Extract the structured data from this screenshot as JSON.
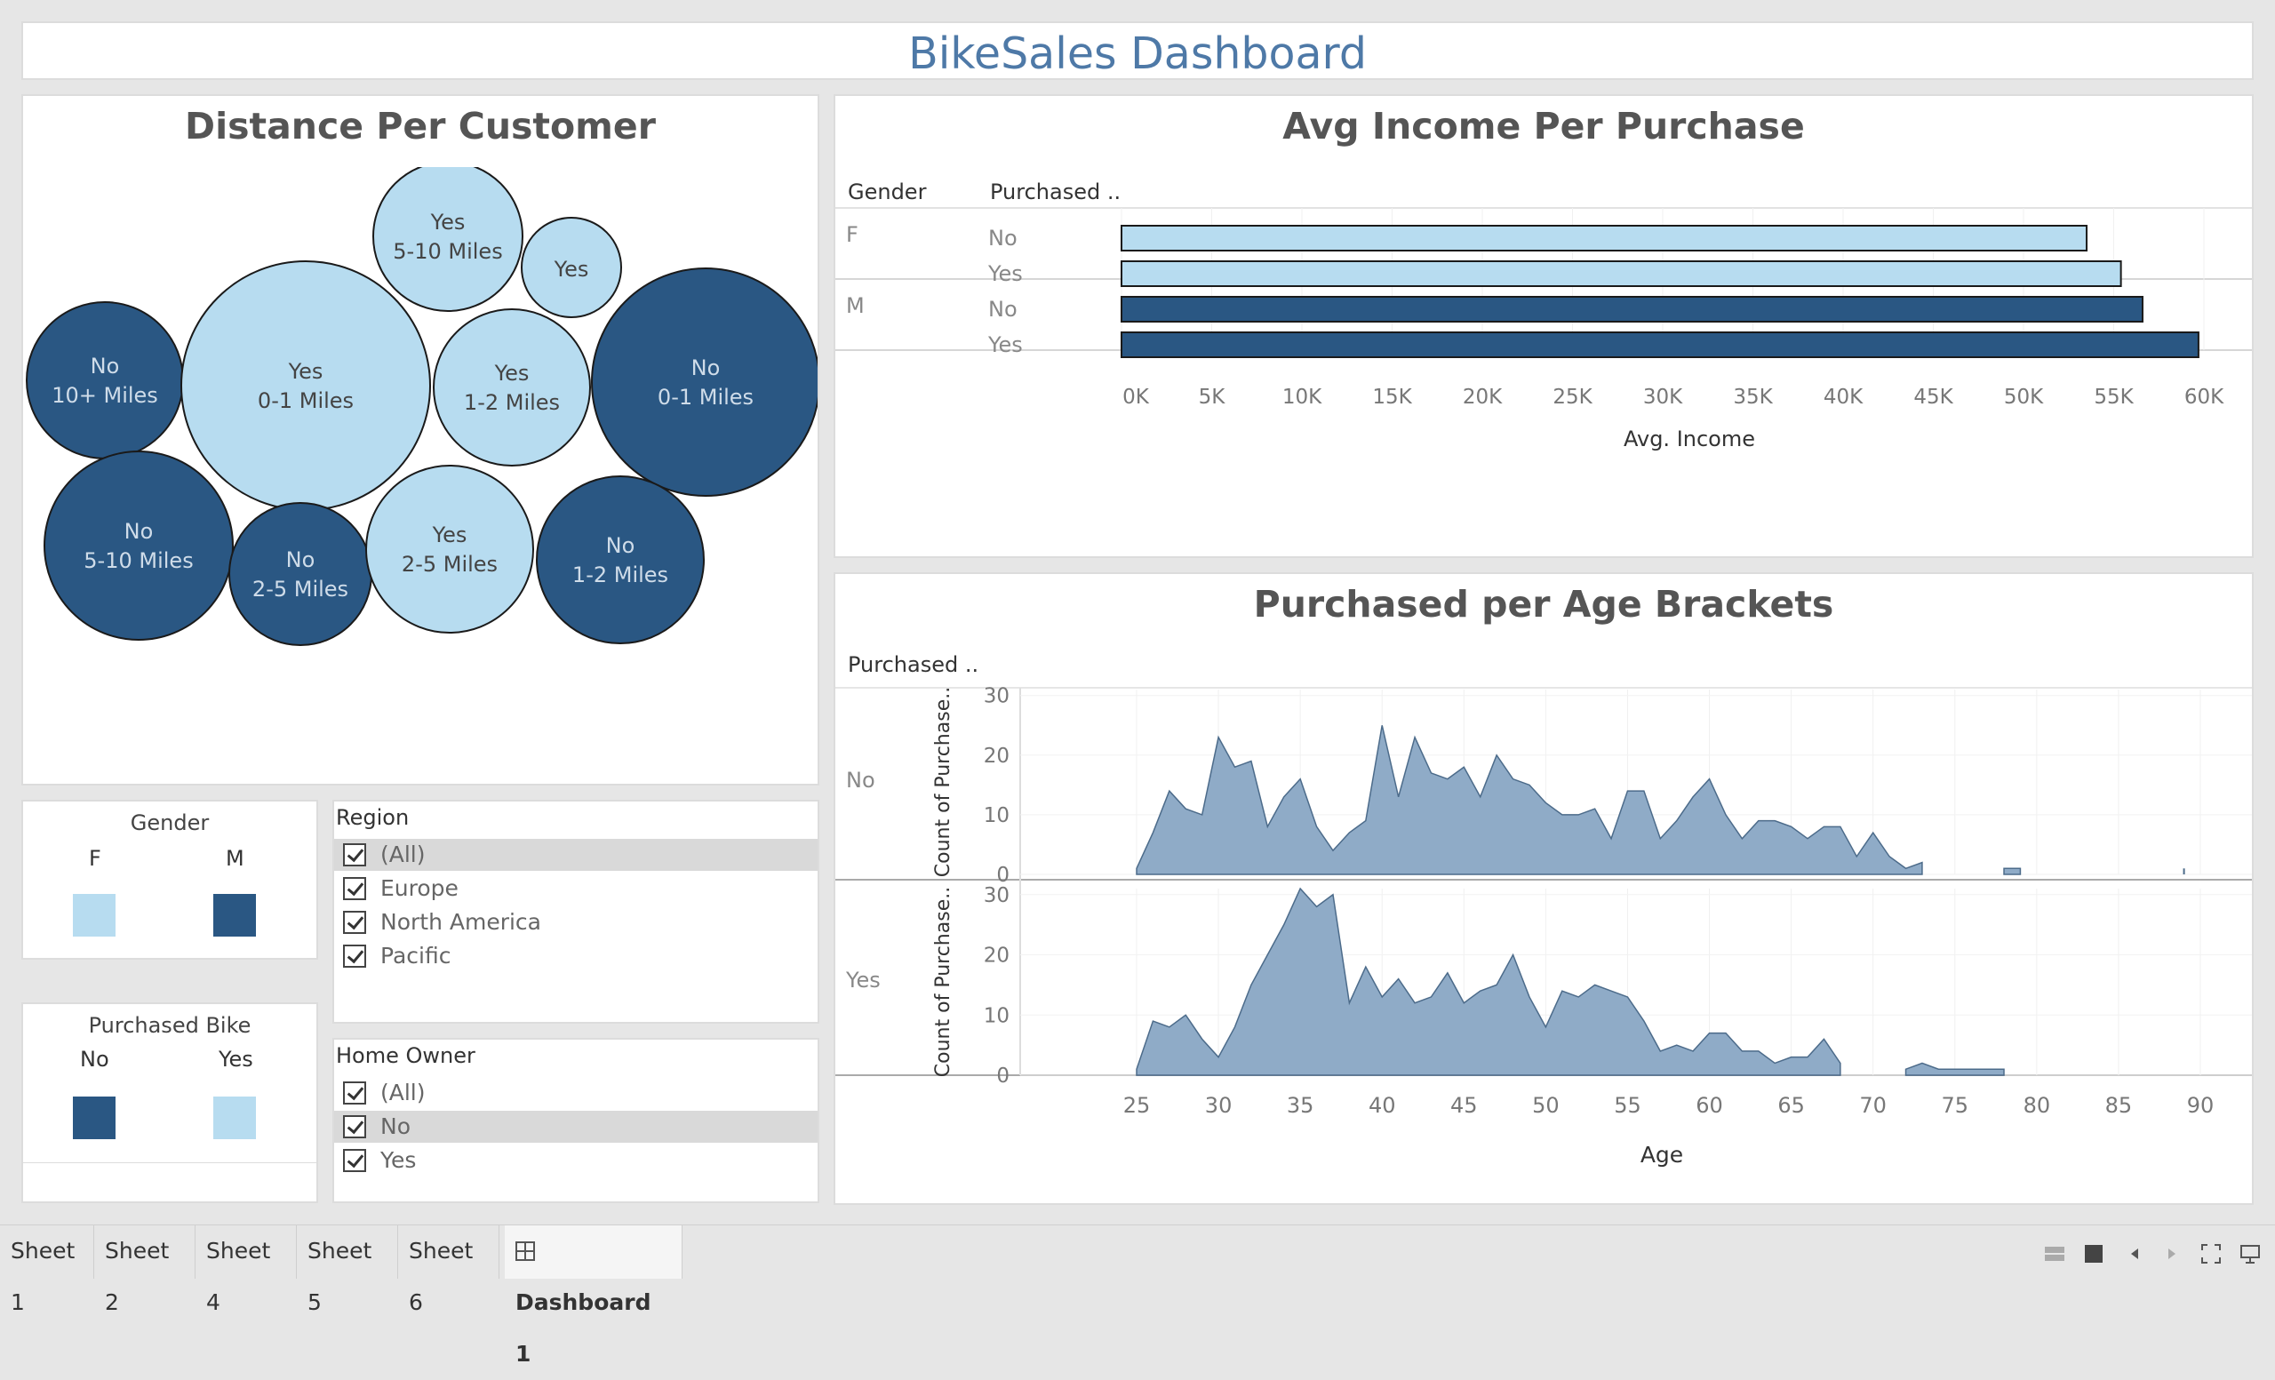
{
  "dashboard": {
    "title": "BikeSales Dashboard"
  },
  "colors": {
    "light": "#b7dcf0",
    "dark": "#2a5783",
    "area": "#8fabc7",
    "area_line": "#4c6b8a",
    "title_blue": "#4e79a7"
  },
  "distance": {
    "title": "Distance Per Customer",
    "bubbles": [
      {
        "l1": "Yes",
        "l2": "5-10 Miles",
        "color": "light"
      },
      {
        "l1": "Yes",
        "l2": "",
        "color": "light"
      },
      {
        "l1": "No",
        "l2": "10+ Miles",
        "color": "dark"
      },
      {
        "l1": "Yes",
        "l2": "0-1 Miles",
        "color": "light"
      },
      {
        "l1": "Yes",
        "l2": "1-2 Miles",
        "color": "light"
      },
      {
        "l1": "No",
        "l2": "0-1 Miles",
        "color": "dark"
      },
      {
        "l1": "No",
        "l2": "5-10 Miles",
        "color": "dark"
      },
      {
        "l1": "No",
        "l2": "2-5 Miles",
        "color": "dark"
      },
      {
        "l1": "Yes",
        "l2": "2-5 Miles",
        "color": "light"
      },
      {
        "l1": "No",
        "l2": "1-2 Miles",
        "color": "dark"
      }
    ]
  },
  "income": {
    "title": "Avg Income Per Purchase",
    "col_gender": "Gender",
    "col_purchased": "Purchased ..",
    "xlabel": "Avg. Income",
    "ticks": [
      "0K",
      "5K",
      "10K",
      "15K",
      "20K",
      "25K",
      "30K",
      "35K",
      "40K",
      "45K",
      "50K",
      "55K",
      "60K"
    ]
  },
  "age": {
    "title": "Purchased per Age Brackets",
    "col_purchased": "Purchased ..",
    "ylabel": "Count of Purchase..",
    "row_no": "No",
    "row_yes": "Yes",
    "xlabel": "Age",
    "yticks": [
      "30",
      "20",
      "10",
      "0"
    ],
    "xticks": [
      "25",
      "30",
      "35",
      "40",
      "45",
      "50",
      "55",
      "60",
      "65",
      "70",
      "75",
      "80",
      "85",
      "90"
    ]
  },
  "gender_legend": {
    "title": "Gender",
    "f": "F",
    "m": "M"
  },
  "purchased_legend": {
    "title": "Purchased Bike",
    "no": "No",
    "yes": "Yes"
  },
  "region": {
    "title": "Region",
    "items": [
      "(All)",
      "Europe",
      "North America",
      "Pacific"
    ]
  },
  "home_owner": {
    "title": "Home Owner",
    "items": [
      "(All)",
      "No",
      "Yes"
    ]
  },
  "tabs": [
    "Sheet 1",
    "Sheet 2",
    "Sheet 4",
    "Sheet 5",
    "Sheet 6",
    "Dashboard 1"
  ],
  "chart_data": [
    {
      "type": "bar",
      "title": "Avg Income Per Purchase",
      "xlabel": "Avg. Income",
      "xlim": [
        0,
        60000
      ],
      "rows": [
        {
          "gender": "F",
          "purchased": "No",
          "value": 53500
        },
        {
          "gender": "F",
          "purchased": "Yes",
          "value": 55400
        },
        {
          "gender": "M",
          "purchased": "No",
          "value": 56600
        },
        {
          "gender": "M",
          "purchased": "Yes",
          "value": 59700
        }
      ]
    },
    {
      "type": "area",
      "title": "Purchased per Age Brackets",
      "xlabel": "Age",
      "ylabel": "Count of Purchase..",
      "xlim": [
        23,
        92
      ],
      "ylim": [
        0,
        30
      ],
      "series": [
        {
          "name": "No",
          "x": [
            25,
            26,
            27,
            28,
            29,
            30,
            31,
            32,
            33,
            34,
            35,
            36,
            37,
            38,
            39,
            40,
            41,
            42,
            43,
            44,
            45,
            46,
            47,
            48,
            49,
            50,
            51,
            52,
            53,
            54,
            55,
            56,
            57,
            58,
            59,
            60,
            61,
            62,
            63,
            64,
            65,
            66,
            67,
            68,
            69,
            70,
            71,
            72,
            73,
            78,
            79,
            89
          ],
          "y": [
            1,
            7,
            14,
            11,
            10,
            23,
            18,
            19,
            8,
            13,
            16,
            8,
            4,
            7,
            9,
            25,
            13,
            23,
            17,
            16,
            18,
            13,
            20,
            16,
            15,
            12,
            10,
            10,
            11,
            6,
            14,
            14,
            6,
            9,
            13,
            16,
            10,
            6,
            9,
            9,
            8,
            6,
            8,
            8,
            3,
            7,
            3,
            1,
            2,
            1,
            1,
            1
          ]
        },
        {
          "name": "Yes",
          "x": [
            25,
            26,
            27,
            28,
            29,
            30,
            31,
            32,
            33,
            34,
            35,
            36,
            37,
            38,
            39,
            40,
            41,
            42,
            43,
            44,
            45,
            46,
            47,
            48,
            49,
            50,
            51,
            52,
            53,
            54,
            55,
            56,
            57,
            58,
            59,
            60,
            61,
            62,
            63,
            64,
            65,
            66,
            67,
            68,
            72,
            73,
            74,
            75,
            76,
            77,
            78
          ],
          "y": [
            1,
            9,
            8,
            10,
            6,
            3,
            8,
            15,
            20,
            25,
            31,
            28,
            30,
            12,
            18,
            13,
            16,
            12,
            13,
            17,
            12,
            14,
            15,
            20,
            13,
            8,
            14,
            13,
            15,
            14,
            13,
            9,
            4,
            5,
            4,
            7,
            7,
            4,
            4,
            2,
            3,
            3,
            6,
            2,
            1,
            2,
            1,
            1,
            1,
            1,
            1
          ]
        }
      ]
    }
  ]
}
